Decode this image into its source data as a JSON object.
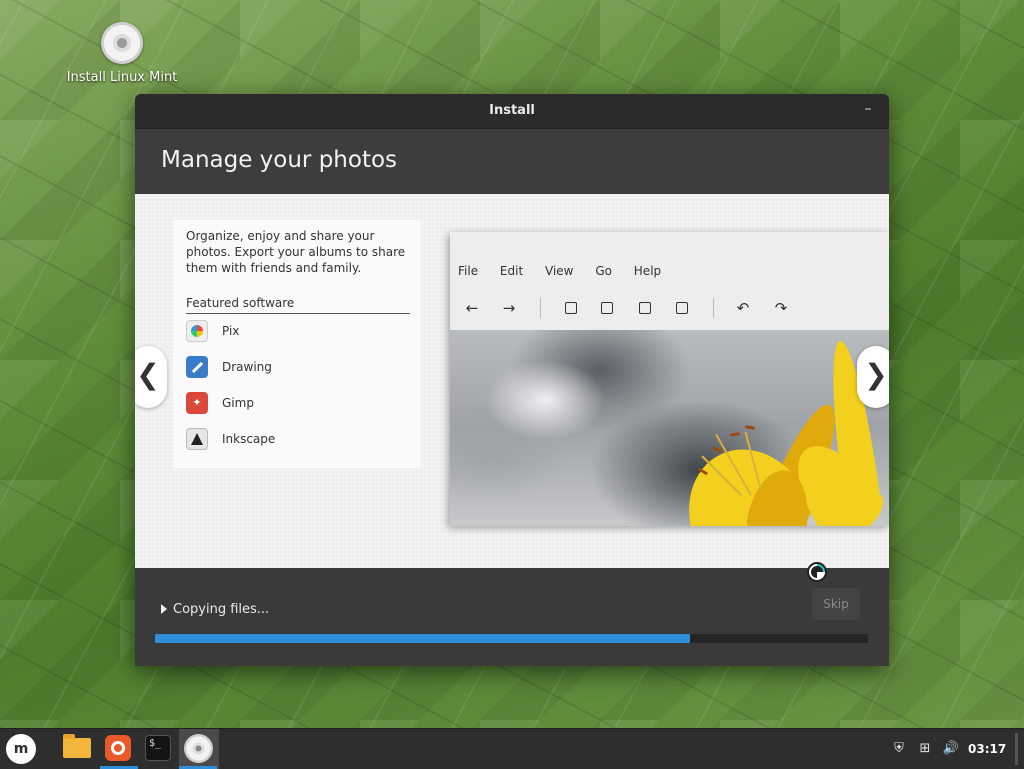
{
  "desktop": {
    "icon_label": "Install Linux Mint"
  },
  "window": {
    "title": "Install",
    "minimize_glyph": "–",
    "header_title": "Manage your photos"
  },
  "slide": {
    "description": "Organize, enjoy and share your photos. Export your albums to share them with friends and family.",
    "featured_label": "Featured software",
    "apps": [
      {
        "name": "Pix",
        "icon": "pix-icon"
      },
      {
        "name": "Drawing",
        "icon": "drawing-icon"
      },
      {
        "name": "Gimp",
        "icon": "gimp-icon"
      },
      {
        "name": "Inkscape",
        "icon": "inkscape-icon"
      }
    ],
    "screenshot_menu": [
      "File",
      "Edit",
      "View",
      "Go",
      "Help"
    ],
    "prev_glyph": "❮",
    "next_glyph": "❯"
  },
  "footer": {
    "status": "Copying files...",
    "skip_label": "Skip",
    "progress": 0.75
  },
  "taskbar": {
    "menu_glyph": "m",
    "clock": "03:17"
  },
  "colors": {
    "accent": "#2e8fd8",
    "header_bg": "#3d3d3d"
  }
}
